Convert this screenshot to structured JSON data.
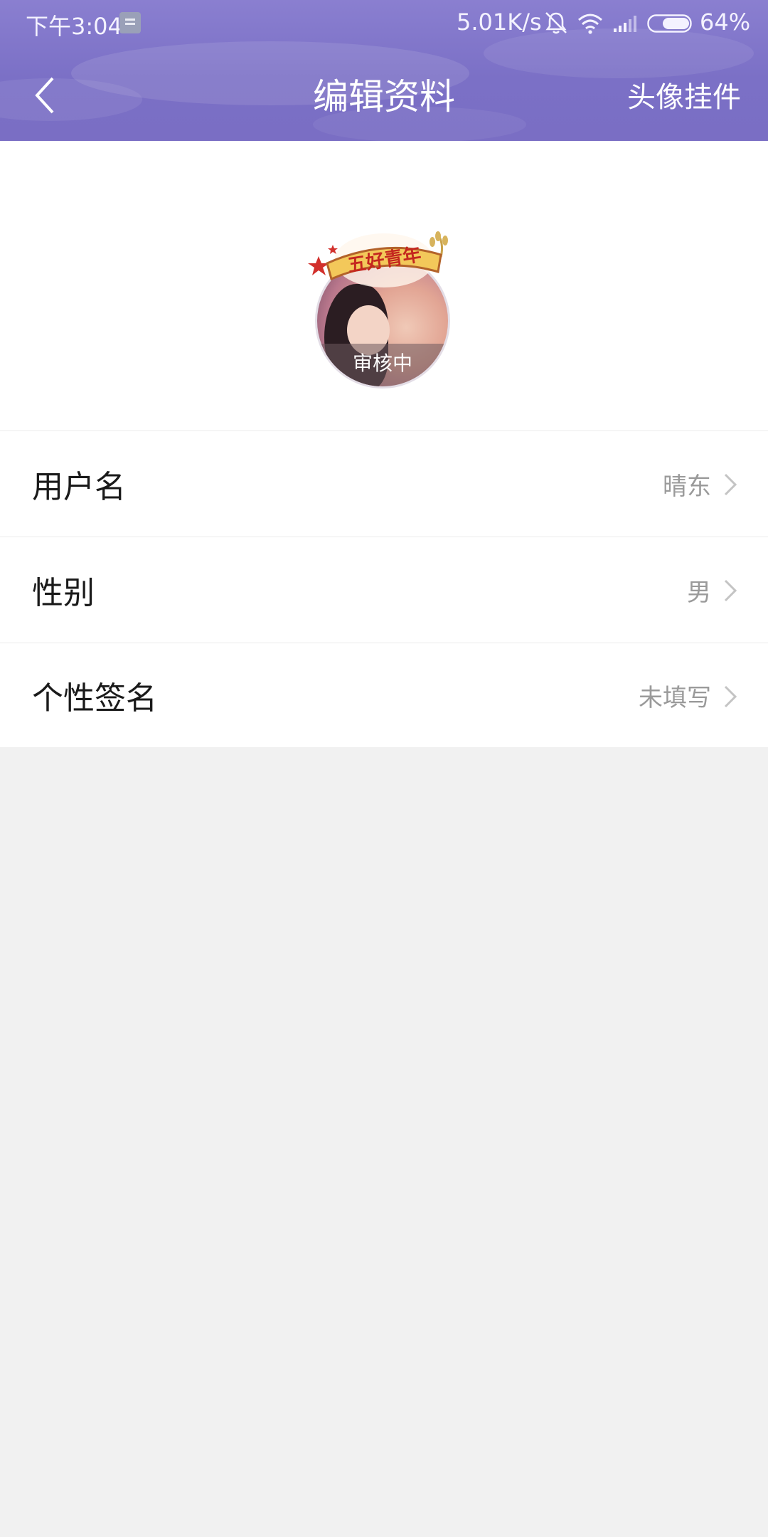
{
  "status_bar": {
    "time": "下午3:04",
    "net_speed": "5.01K/s",
    "battery": "64%"
  },
  "header": {
    "title": "编辑资料",
    "right_action": "头像挂件"
  },
  "avatar": {
    "review_status": "审核中",
    "pendant_text": "五好青年"
  },
  "profile_rows": [
    {
      "label": "用户名",
      "value": "晴东"
    },
    {
      "label": "性别",
      "value": "男"
    },
    {
      "label": "个性签名",
      "value": "未填写"
    }
  ],
  "colors": {
    "header_purple": "#7b70c6",
    "background": "#f1f1f1",
    "value_gray": "#9a9a9a"
  }
}
